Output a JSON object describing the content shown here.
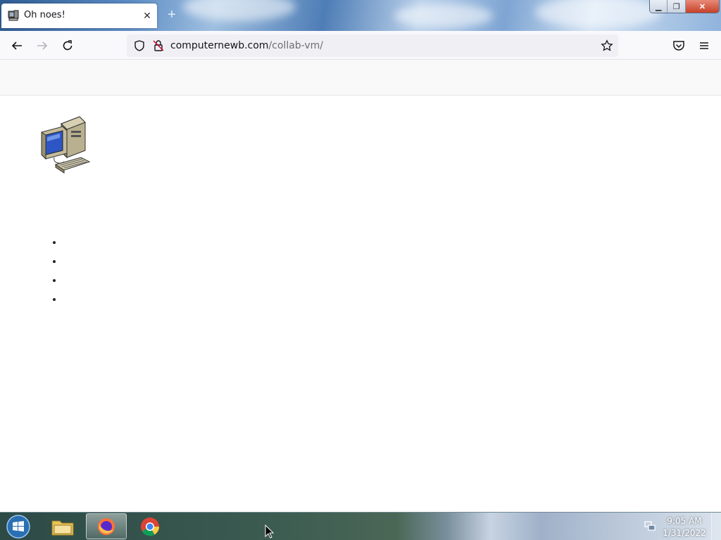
{
  "browser": {
    "tab": {
      "title": "Oh noes!",
      "favicon": "computer-icon"
    },
    "new_tab_label": "+",
    "close_tab_label": "✕",
    "url": {
      "domain": "computernewb.com",
      "path": "/collab-vm/"
    },
    "window_buttons": {
      "minimize": "▁",
      "maximize": "❐",
      "close": "✕"
    }
  },
  "page": {
    "logo_icon": "desktop-computer-icon",
    "list_items": [
      "",
      "",
      "",
      ""
    ]
  },
  "taskbar": {
    "items": [
      "start-orb",
      "windows-explorer",
      "firefox",
      "chrome"
    ],
    "active_item": "firefox",
    "clock": {
      "time": "9:05 AM",
      "date": "1/31/2022"
    }
  },
  "colors": {
    "accent": "#0060df",
    "toolbar": "#f9f9fb",
    "urlbar": "#f0f0f4"
  }
}
